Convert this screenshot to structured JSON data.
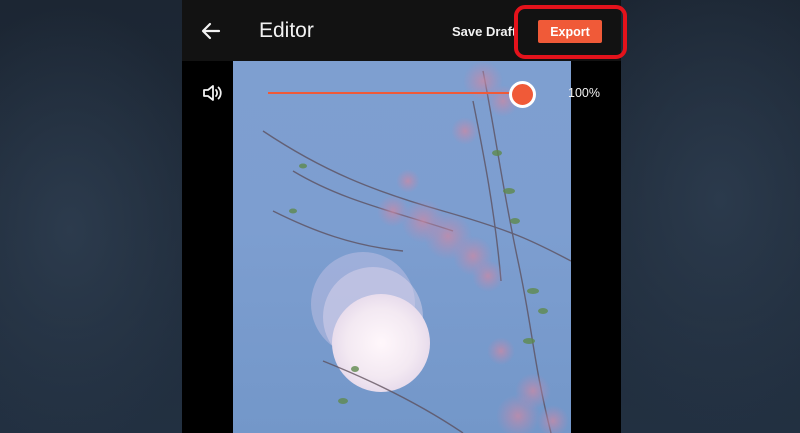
{
  "header": {
    "back_icon": "arrow-left-icon",
    "title": "Editor",
    "save_draft_label": "Save Draft",
    "export_label": "Export"
  },
  "volume": {
    "icon": "speaker-icon",
    "level": 1.0,
    "value_text": "100%"
  },
  "colors": {
    "accent": "#f05a38",
    "highlight": "#e4121b",
    "topbar": "#121212"
  }
}
